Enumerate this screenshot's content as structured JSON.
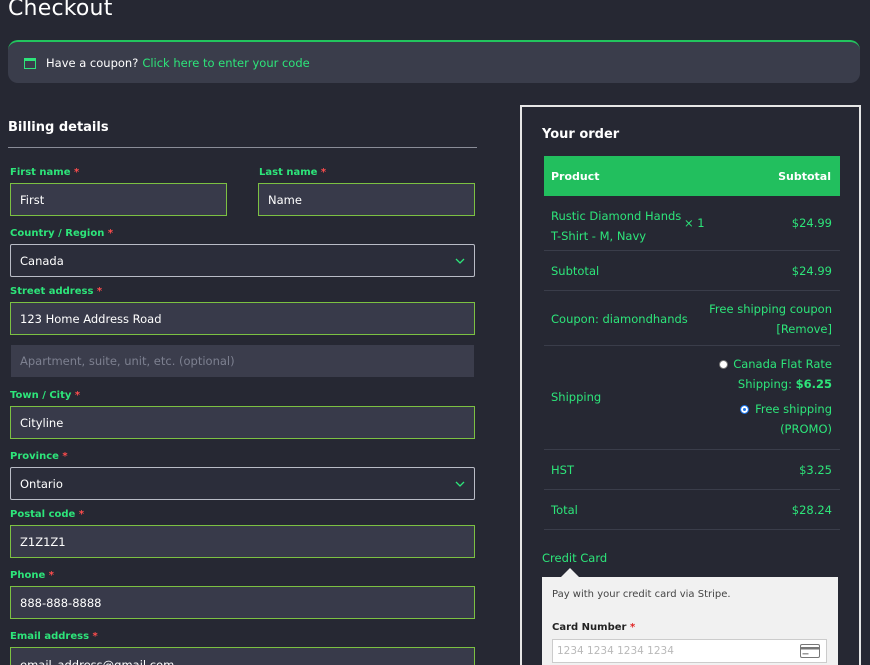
{
  "page": {
    "title": "Checkout"
  },
  "coupon": {
    "prompt": "Have a coupon?",
    "link": "Click here to enter your code"
  },
  "billing": {
    "title": "Billing details",
    "first_name": {
      "label": "First name",
      "value": "First"
    },
    "last_name": {
      "label": "Last name",
      "value": "Name"
    },
    "country": {
      "label": "Country / Region",
      "value": "Canada"
    },
    "street": {
      "label": "Street address",
      "value": "123 Home Address Road",
      "placeholder2": "Apartment, suite, unit, etc. (optional)"
    },
    "city": {
      "label": "Town / City",
      "value": "Cityline"
    },
    "province": {
      "label": "Province",
      "value": "Ontario"
    },
    "postal": {
      "label": "Postal code",
      "value": "Z1Z1Z1"
    },
    "phone": {
      "label": "Phone",
      "value": "888-888-8888"
    },
    "email": {
      "label": "Email address",
      "value": "email_address@gmail.com"
    },
    "required_mark": "*"
  },
  "order": {
    "title": "Your order",
    "head_product": "Product",
    "head_subtotal": "Subtotal",
    "item": {
      "name_line1": "Rustic Diamond Hands",
      "name_line2": "T-Shirt - M, Navy",
      "qty": "× 1",
      "price": "$24.99"
    },
    "subtotal": {
      "label": "Subtotal",
      "value": "$24.99"
    },
    "coupon": {
      "label": "Coupon: diamondhands",
      "value_line1": "Free shipping coupon",
      "remove": "[Remove]"
    },
    "shipping": {
      "label": "Shipping",
      "option1_line1": "Canada Flat Rate",
      "option1_line2": "Shipping:",
      "option1_price": "$6.25",
      "option2_line1": "Free shipping",
      "option2_line2": "(PROMO)"
    },
    "hst": {
      "label": "HST",
      "value": "$3.25"
    },
    "total": {
      "label": "Total",
      "value": "$28.24"
    }
  },
  "payment": {
    "method": "Credit Card",
    "description": "Pay with your credit card via Stripe.",
    "card_number_label": "Card Number",
    "card_number_placeholder": "1234 1234 1234 1234"
  }
}
